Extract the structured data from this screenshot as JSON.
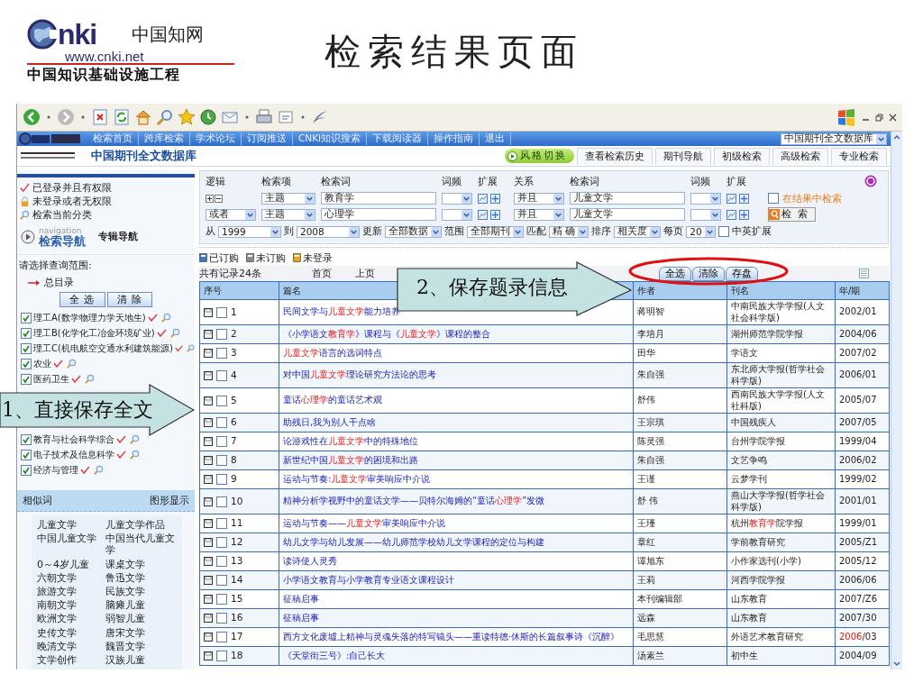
{
  "slide": {
    "title": "检索结果页面",
    "logo": {
      "mark": "nki",
      "name": "中国知网",
      "url": "www.cnki.net",
      "tagline": "中国知识基础设施工程"
    }
  },
  "site": {
    "nav_links": [
      "检索首页",
      "跨库检索",
      "学术论坛",
      "订阅推送",
      "CNKI知识搜索",
      "下载阅读器",
      "操作指南",
      "退出"
    ],
    "database_select": "中国期刊全文数据库",
    "database_title": "中国期刊全文数据库",
    "style_switch": "风格切换",
    "tabs": [
      {
        "label": "查看检索历史",
        "selected": false
      },
      {
        "label": "期刊导航",
        "selected": false
      },
      {
        "label": "初级检索",
        "selected": false
      },
      {
        "label": "高级检索",
        "selected": false
      },
      {
        "label": "专业检索",
        "selected": false
      }
    ]
  },
  "sidebar": {
    "status": [
      {
        "label": "已登录并且有权限",
        "kind": "check"
      },
      {
        "label": "未登录或者无权限",
        "kind": "lock"
      },
      {
        "label": "检索当前分类",
        "kind": "search"
      }
    ],
    "navigation": {
      "caption": "navigation",
      "label": "检索导航",
      "alt": "专辑导航"
    },
    "scope": {
      "prompt": "请选择查询范围:",
      "root": "总目录",
      "buttons": [
        "全 选",
        "清 除"
      ],
      "categories": [
        {
          "label": "理工A(数学物理力学天地生)",
          "checked": true
        },
        {
          "label": "理工B(化学化工冶金环境矿业)",
          "checked": true
        },
        {
          "label": "理工C(机电航空交通水利建筑能源)",
          "checked": true
        },
        {
          "label": "农业",
          "checked": true
        },
        {
          "label": "医药卫生",
          "checked": true
        },
        {
          "label": "教育与社会科学综合",
          "checked": true
        },
        {
          "label": "电子技术及信息科学",
          "checked": true
        },
        {
          "label": "经济与管理",
          "checked": true
        }
      ]
    },
    "similar": {
      "title": "相似词",
      "action": "图形显示",
      "words": [
        "儿童文学",
        "儿童文学作品",
        "中国儿童文学",
        "中国当代儿童文学",
        "0～4岁儿童",
        "课桌文学",
        "六朝文学",
        "鲁迅文学",
        "旅游文学",
        "民族文学",
        "南朝文学",
        "脑瘫儿童",
        "欧洲文学",
        "弱智儿童",
        "史传文学",
        "唐宋文学",
        "晚清文学",
        "魏晋文学",
        "文学创作",
        "汉族儿童"
      ]
    }
  },
  "search_form": {
    "headers": [
      "逻辑",
      "检索项",
      "检索词",
      "词频",
      "扩展",
      "关系",
      "检索词",
      "词频",
      "扩展"
    ],
    "rows": [
      {
        "field": "主题",
        "term": "教育学",
        "relation": "并且",
        "term2": "儿童文学"
      },
      {
        "logic": "或者",
        "field": "主题",
        "term": "心理学",
        "relation": "并且",
        "term2": "儿童文学"
      }
    ],
    "in_results": {
      "label": "在结果中检索",
      "checked": false
    },
    "search_button": "检 索",
    "options": [
      {
        "label": "从",
        "value": "1999"
      },
      {
        "label": "到",
        "value": "2008"
      },
      {
        "label": "更新",
        "value": "全部数据"
      },
      {
        "label": "范围",
        "value": "全部期刊"
      },
      {
        "label": "匹配",
        "value": "精 确"
      },
      {
        "label": "排序",
        "value": "相关度"
      },
      {
        "label": "每页",
        "value": "20"
      }
    ],
    "bilingual": {
      "label": "中英扩展",
      "checked": false
    }
  },
  "legend": [
    {
      "label": "已订购",
      "kind": "subscribed"
    },
    {
      "label": "未订购",
      "kind": "unsubscribed"
    },
    {
      "label": "未登录",
      "kind": "guest"
    }
  ],
  "results": {
    "count": "共有记录24条",
    "pager": [
      "首页",
      "上页"
    ],
    "buttons": [
      "全选",
      "清除",
      "存盘"
    ]
  },
  "table": {
    "columns": [
      "序号",
      "篇名",
      "作者",
      "刊名",
      "年/期"
    ],
    "rows": [
      {
        "no": "1",
        "checked": false,
        "title": [
          {
            "text": "民间文学与"
          },
          {
            "text": "儿童文学",
            "hit": true
          },
          {
            "text": "能力培养"
          }
        ],
        "author": "蒋明智",
        "journal": "中南民族大学学报(人文社会科学版)",
        "year": "2002/01"
      },
      {
        "no": "2",
        "checked": false,
        "title": [
          {
            "text": "《小学语文"
          },
          {
            "text": "教育学",
            "hit": true
          },
          {
            "text": "》课程与《"
          },
          {
            "text": "儿童文学",
            "hit": true
          },
          {
            "text": "》课程的整合"
          }
        ],
        "author": "李培月",
        "journal": "湖州师范学院学报",
        "year": "2004/06"
      },
      {
        "no": "3",
        "checked": false,
        "title": [
          {
            "text": "儿童文学",
            "hit": true
          },
          {
            "text": "语言的选词特点"
          }
        ],
        "author": "田华",
        "journal": "学语文",
        "year": "2007/02"
      },
      {
        "no": "4",
        "checked": false,
        "title": [
          {
            "text": "对中国"
          },
          {
            "text": "儿童文学",
            "hit": true
          },
          {
            "text": "理论研究方法论的思考"
          }
        ],
        "author": "朱自强",
        "journal": "东北师大学报(哲学社会科学版)",
        "year": "2006/01"
      },
      {
        "no": "5",
        "checked": false,
        "title": [
          {
            "text": "童话"
          },
          {
            "text": "心理学",
            "hit": true
          },
          {
            "text": "的童话艺术观"
          }
        ],
        "author": "舒伟",
        "journal": "西南民族大学学报(人文社科版)",
        "year": "2005/07"
      },
      {
        "no": "6",
        "checked": false,
        "title": "助残日,我为别人干点啥",
        "author": "王宗琪",
        "journal": "中国残疾人",
        "year": "2007/05"
      },
      {
        "no": "7",
        "checked": false,
        "title": [
          {
            "text": "论游戏性在"
          },
          {
            "text": "儿童文学",
            "hit": true
          },
          {
            "text": "中的特殊地位"
          }
        ],
        "author": "陈灵强",
        "journal": "台州学院学报",
        "year": "1999/04"
      },
      {
        "no": "8",
        "checked": false,
        "title": [
          {
            "text": "新世纪中国"
          },
          {
            "text": "儿童文学",
            "hit": true
          },
          {
            "text": "的困境和出路"
          }
        ],
        "author": "朱自强",
        "journal": "文艺争鸣",
        "year": "2006/02"
      },
      {
        "no": "9",
        "checked": false,
        "title": [
          {
            "text": "运动与节奏:"
          },
          {
            "text": "儿童文学",
            "hit": true
          },
          {
            "text": "审美响应中介说"
          }
        ],
        "author": "王谨",
        "journal": "云梦学刊",
        "year": "1999/02"
      },
      {
        "no": "10",
        "checked": false,
        "title": [
          {
            "text": "精神分析学视野中的童话文学——贝特尔海姆的“童话"
          },
          {
            "text": "心理学",
            "hit": true
          },
          {
            "text": "”发微"
          }
        ],
        "author": "舒 伟",
        "journal": "燕山大学学报(哲学社会科学版)",
        "year": "2001/01"
      },
      {
        "no": "11",
        "checked": false,
        "title": [
          {
            "text": "运动与节奏——"
          },
          {
            "text": "儿童文学",
            "hit": true
          },
          {
            "text": "审美响应中介说"
          }
        ],
        "author": "王瑾",
        "journal": [
          {
            "text": "杭州"
          },
          {
            "text": "教育学",
            "hit": true
          },
          {
            "text": "院学报"
          }
        ],
        "year": "1999/01"
      },
      {
        "no": "12",
        "checked": false,
        "title": "幼儿文学与幼儿发展——幼儿师范学校幼儿文学课程的定位与构建",
        "author": "章红",
        "journal": "学前教育研究",
        "year": "2005/Z1"
      },
      {
        "no": "13",
        "checked": false,
        "title": "读诗使人灵秀",
        "author": "谭旭东",
        "journal": "小作家选刊(小学)",
        "year": "2005/12"
      },
      {
        "no": "14",
        "checked": false,
        "title": "小学语文教育与小学教育专业语文课程设计",
        "author": "王莉",
        "journal": "河西学院学报",
        "year": "2006/06"
      },
      {
        "no": "15",
        "checked": false,
        "title": "征稿启事",
        "author": "本刊编辑部",
        "journal": "山东教育",
        "year": "2007/Z6"
      },
      {
        "no": "16",
        "checked": false,
        "title": "征稿启事",
        "author": "远森",
        "journal": "山东教育",
        "year": "2007/30"
      },
      {
        "no": "17",
        "checked": false,
        "title": "西方文化废墟上精神与灵魂失落的特写镜头——重读特德·休斯的长篇叙事诗《沉醉》",
        "author": "毛思慧",
        "journal": "外语艺术教育研究",
        "year": [
          {
            "text": "2006",
            "hit": true
          },
          {
            "text": "/03"
          }
        ]
      },
      {
        "no": "18",
        "checked": false,
        "title": "《天堂街三号》:自己长大",
        "author": "汤素兰",
        "journal": "初中生",
        "year": "2004/09"
      }
    ]
  },
  "callouts": [
    {
      "text": "1、直接保存全文"
    },
    {
      "text": "2、保存题录信息"
    }
  ]
}
